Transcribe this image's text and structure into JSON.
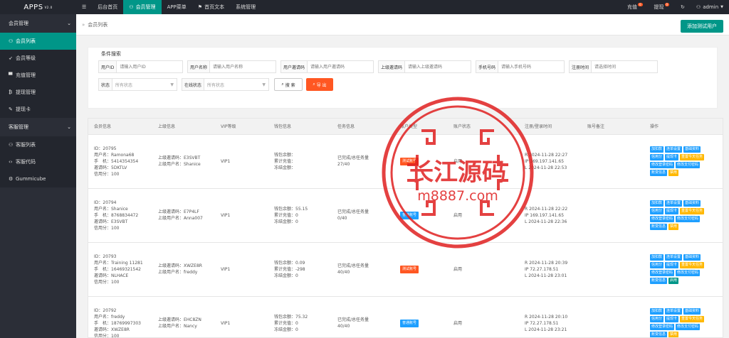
{
  "topbar": {
    "logo": "APPS",
    "version": "V2.0",
    "menu_icon": "hamburger-icon",
    "nav": [
      {
        "label": "后台首页",
        "icon": ""
      },
      {
        "label": "会员管理",
        "icon": "user-icon"
      },
      {
        "label": "APP菜单",
        "icon": ""
      },
      {
        "label": "首页文本",
        "icon": "flag-icon"
      },
      {
        "label": "系统管理",
        "icon": ""
      }
    ],
    "recharge": "充值",
    "recharge_badge": "0",
    "withdraw": "提现",
    "withdraw_badge": "0",
    "user": "admin"
  },
  "sidebar": {
    "groups": [
      {
        "label": "会员管理",
        "items": [
          {
            "label": "会员列表",
            "icon": "user-icon"
          },
          {
            "label": "会员等级",
            "icon": "rocket-icon"
          },
          {
            "label": "充值管理",
            "icon": "shop-icon"
          },
          {
            "label": "提现管理",
            "icon": "bitcoin-icon"
          },
          {
            "label": "提现卡",
            "icon": "credit-card-icon"
          }
        ]
      },
      {
        "label": "客服管理",
        "items": [
          {
            "label": "客服列表",
            "icon": "users-icon"
          },
          {
            "label": "客服代码",
            "icon": "code-icon"
          },
          {
            "label": "Gummicube",
            "icon": "gear-icon"
          }
        ]
      }
    ]
  },
  "crumb": {
    "label": "会员列表",
    "add_button": "添加测试用户"
  },
  "search": {
    "legend": "条件搜索",
    "fields": [
      {
        "label": "用户ID",
        "placeholder": "请输入用户ID"
      },
      {
        "label": "用户名称",
        "placeholder": "请输入用户名称"
      },
      {
        "label": "用户邀请码",
        "placeholder": "请输入用户邀请码"
      },
      {
        "label": "上级邀请码",
        "placeholder": "请输入上级邀请码"
      },
      {
        "label": "手机号码",
        "placeholder": "请输入手机号码"
      },
      {
        "label": "注册时间",
        "placeholder": "请选择时间"
      }
    ],
    "status_label": "状态",
    "status_value": "所有状态",
    "online_label": "在线状态",
    "online_value": "所有状态",
    "search_btn": "搜 索",
    "export_btn": "导 出"
  },
  "table": {
    "headers": [
      "会员信息",
      "上级信息",
      "VIP等级",
      "钱包信息",
      "任务信息",
      "账户类型",
      "账户状态",
      "注册/登录时间",
      "账号备注",
      "操作"
    ],
    "rows": [
      {
        "member": [
          "ID：20795",
          "用户名：Ramona68",
          "手　机：5414354354",
          "邀请码：5DKTLV",
          "信用分：100"
        ],
        "parent": [
          "上级邀请码：E3SVBT",
          "上级用户名：Shanice"
        ],
        "vip": "VIP1",
        "wallet": [
          "钱包余额：",
          "累计充值：",
          "冻结金额："
        ],
        "task": [
          "已完成/总任务量",
          "27/40"
        ],
        "type": "测试账号",
        "type_color": "#ff5722",
        "status": "启用",
        "times": [
          "R 2024-11-28 22:27",
          "IP 169.197.141.65",
          "L 2024-11-28 22:53"
        ],
        "ops": [
          [
            "加扣款",
            "#1e9fff"
          ],
          [
            "连单设置",
            "#1e9fff"
          ],
          [
            "基础资料",
            "#1e9fff"
          ],
          [
            "信用分",
            "#1e9fff"
          ],
          [
            "提现卡",
            "#1e9fff"
          ],
          [
            "重置今天任务",
            "#ffb800"
          ],
          [
            "修改登录密码",
            "#1e9fff"
          ],
          [
            "修改支付密码",
            "#1e9fff"
          ],
          [
            "账变信息",
            "#1e9fff"
          ],
          [
            "禁用",
            "#ffb800"
          ]
        ]
      },
      {
        "member": [
          "ID：20794",
          "用户名：Shanice",
          "手　机：8768834472",
          "邀请码：E3SVBT",
          "信用分：100"
        ],
        "parent": [
          "上级邀请码：E7P4LF",
          "上级用户名：Anna007"
        ],
        "vip": "VIP1",
        "wallet": [
          "钱包余额：55.15",
          "累计充值：0",
          "冻结金额：0"
        ],
        "task": [
          "已完成/总任务量",
          "0/40"
        ],
        "type": "普通账号",
        "type_color": "#1e9fff",
        "status": "启用",
        "times": [
          "R 2024-11-28 22:22",
          "IP 169.197.141.65",
          "L 2024-11-28 22:36"
        ],
        "ops": [
          [
            "加扣款",
            "#1e9fff"
          ],
          [
            "连单设置",
            "#1e9fff"
          ],
          [
            "基础资料",
            "#1e9fff"
          ],
          [
            "信用分",
            "#1e9fff"
          ],
          [
            "提现卡",
            "#1e9fff"
          ],
          [
            "重置今天任务",
            "#ffb800"
          ],
          [
            "修改登录密码",
            "#1e9fff"
          ],
          [
            "修改支付密码",
            "#1e9fff"
          ],
          [
            "账变信息",
            "#1e9fff"
          ],
          [
            "禁用",
            "#ffb800"
          ]
        ]
      },
      {
        "member": [
          "ID：20793",
          "用户名：Training 11281",
          "手　机：16469321542",
          "邀请码：NLHACE",
          "信用分：100"
        ],
        "parent": [
          "上级邀请码：XWZE8R",
          "上级用户名：freddy"
        ],
        "vip": "VIP1",
        "wallet": [
          "钱包余额：0.09",
          "累计充值：-298",
          "冻结金额：0"
        ],
        "task": [
          "已完成/总任务量",
          "40/40"
        ],
        "type": "测试账号",
        "type_color": "#ff5722",
        "status": "启用",
        "times": [
          "R 2024-11-28 20:39",
          "IP 72.27.178.51",
          "L 2024-11-28 23:01"
        ],
        "ops": [
          [
            "加扣款",
            "#1e9fff"
          ],
          [
            "连单设置",
            "#1e9fff"
          ],
          [
            "基础资料",
            "#1e9fff"
          ],
          [
            "信用分",
            "#1e9fff"
          ],
          [
            "提现卡",
            "#1e9fff"
          ],
          [
            "重置今天任务",
            "#ffb800"
          ],
          [
            "修改登录密码",
            "#1e9fff"
          ],
          [
            "修改支付密码",
            "#1e9fff"
          ],
          [
            "账变信息",
            "#1e9fff"
          ],
          [
            "启用",
            "#009688"
          ]
        ]
      },
      {
        "member": [
          "ID：20792",
          "用户名：freddy",
          "手　机：18769997303",
          "邀请码：XWZE8R",
          "信用分：100"
        ],
        "parent": [
          "上级邀请码：EHC8ZN",
          "上级用户名：Nancy"
        ],
        "vip": "VIP1",
        "wallet": [
          "钱包余额：75.32",
          "累计充值：0",
          "冻结金额：0"
        ],
        "task": [
          "已完成/总任务量",
          "40/40"
        ],
        "type": "普通账号",
        "type_color": "#1e9fff",
        "status": "启用",
        "times": [
          "R 2024-11-28 20:10",
          "IP 72.27.178.51",
          "L 2024-11-28 23:21"
        ],
        "ops": [
          [
            "加扣款",
            "#1e9fff"
          ],
          [
            "连单设置",
            "#1e9fff"
          ],
          [
            "基础资料",
            "#1e9fff"
          ],
          [
            "信用分",
            "#1e9fff"
          ],
          [
            "提现卡",
            "#1e9fff"
          ],
          [
            "重置今天任务",
            "#ffb800"
          ],
          [
            "修改登录密码",
            "#1e9fff"
          ],
          [
            "修改支付密码",
            "#1e9fff"
          ],
          [
            "账变信息",
            "#1e9fff"
          ],
          [
            "禁用",
            "#ffb800"
          ]
        ]
      }
    ]
  },
  "watermark": {
    "title": "长江源码",
    "site": "m8887.com",
    "color": "#e02020"
  }
}
